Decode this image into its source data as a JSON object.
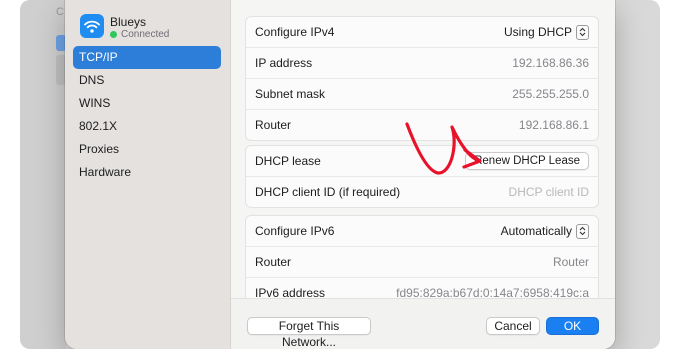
{
  "background": {
    "clipped_label": "C"
  },
  "network": {
    "name": "Blueys",
    "status": "Connected",
    "icon": "wifi-icon"
  },
  "sidebar": {
    "items": [
      {
        "label": "TCP/IP",
        "selected": true
      },
      {
        "label": "DNS"
      },
      {
        "label": "WINS"
      },
      {
        "label": "802.1X"
      },
      {
        "label": "Proxies"
      },
      {
        "label": "Hardware"
      }
    ]
  },
  "ipv4": {
    "configure_label": "Configure IPv4",
    "configure_value": "Using DHCP",
    "ip_label": "IP address",
    "ip_value": "192.168.86.36",
    "subnet_label": "Subnet mask",
    "subnet_value": "255.255.255.0",
    "router_label": "Router",
    "router_value": "192.168.86.1"
  },
  "dhcp": {
    "lease_label": "DHCP lease",
    "renew_button": "Renew DHCP Lease",
    "client_id_label": "DHCP client ID (if required)",
    "client_id_placeholder": "DHCP client ID"
  },
  "ipv6": {
    "configure_label": "Configure IPv6",
    "configure_value": "Automatically",
    "router_label": "Router",
    "router_value": "Router",
    "address_label": "IPv6 address",
    "address_value": "fd95:829a:b67d:0:14a7:6958:419c:a"
  },
  "footer": {
    "forget_button": "Forget This Network...",
    "cancel_button": "Cancel",
    "ok_button": "OK"
  },
  "colors": {
    "accent": "#1a7ff0",
    "annotation_arrow": "#e8132a",
    "status_dot": "#30c75b"
  }
}
